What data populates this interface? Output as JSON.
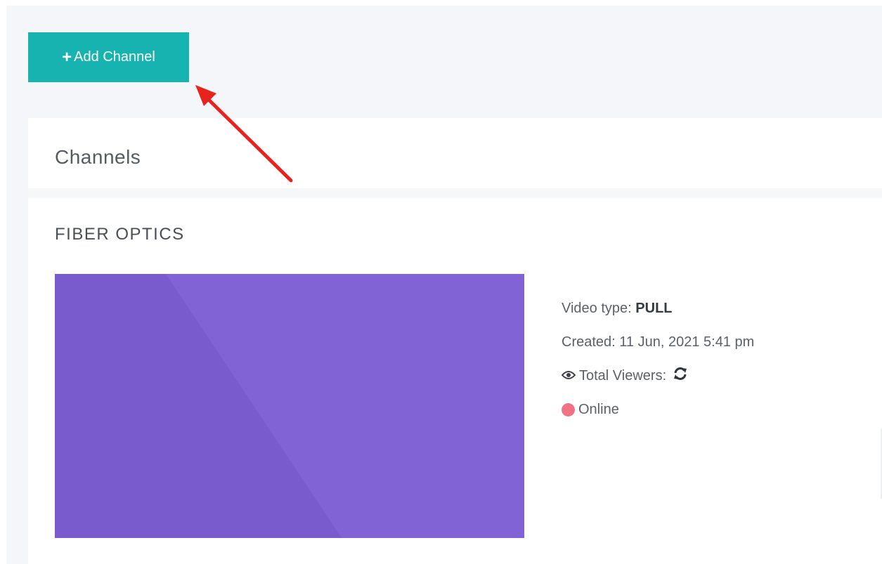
{
  "toolbar": {
    "add_channel_label": "Add Channel",
    "plus_glyph": "+"
  },
  "channels_card": {
    "title": "Channels"
  },
  "channel": {
    "name": "FIBER OPTICS",
    "video_type_label": "Video type:",
    "video_type_value": "PULL",
    "created_label": "Created:",
    "created_value": "11 Jun, 2021 5:41 pm",
    "viewers_label": "Total Viewers:",
    "status": "Online"
  },
  "colors": {
    "button_bg": "#17b3b0",
    "thumbnail": "#8263d6",
    "status_online": "#f07384",
    "annotation_arrow": "#e8231e"
  },
  "icons": {
    "plus": "plus-icon",
    "eye": "eye-icon",
    "refresh": "refresh-icon",
    "status": "status-dot"
  }
}
